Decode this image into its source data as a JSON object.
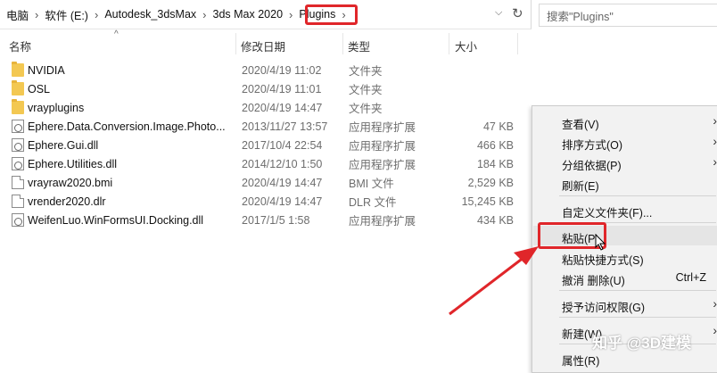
{
  "address": {
    "crumbs": [
      "电脑",
      "软件 (E:)",
      "Autodesk_3dsMax",
      "3ds Max 2020",
      "Plugins"
    ],
    "search_placeholder": "搜索\"Plugins\""
  },
  "columns": {
    "name": "名称",
    "date": "修改日期",
    "type": "类型",
    "size": "大小"
  },
  "files": [
    {
      "name": "NVIDIA",
      "date": "2020/4/19 11:02",
      "type": "文件夹",
      "size": "",
      "icon": "folder-icon"
    },
    {
      "name": "OSL",
      "date": "2020/4/19 11:01",
      "type": "文件夹",
      "size": "",
      "icon": "folder-icon"
    },
    {
      "name": "vrayplugins",
      "date": "2020/4/19 14:47",
      "type": "文件夹",
      "size": "",
      "icon": "folder-icon"
    },
    {
      "name": "Ephere.Data.Conversion.Image.Photo...",
      "date": "2013/11/27 13:57",
      "type": "应用程序扩展",
      "size": "47 KB",
      "icon": "dll-icon"
    },
    {
      "name": "Ephere.Gui.dll",
      "date": "2017/10/4 22:54",
      "type": "应用程序扩展",
      "size": "466 KB",
      "icon": "dll-icon"
    },
    {
      "name": "Ephere.Utilities.dll",
      "date": "2014/12/10 1:50",
      "type": "应用程序扩展",
      "size": "184 KB",
      "icon": "dll-icon"
    },
    {
      "name": "vrayraw2020.bmi",
      "date": "2020/4/19 14:47",
      "type": "BMI 文件",
      "size": "2,529 KB",
      "icon": "file-icon"
    },
    {
      "name": "vrender2020.dlr",
      "date": "2020/4/19 14:47",
      "type": "DLR 文件",
      "size": "15,245 KB",
      "icon": "file-icon"
    },
    {
      "name": "WeifenLuo.WinFormsUI.Docking.dll",
      "date": "2017/1/5 1:58",
      "type": "应用程序扩展",
      "size": "434 KB",
      "icon": "dll-icon"
    }
  ],
  "context_menu": {
    "view": "查看(V)",
    "sort": "排序方式(O)",
    "group": "分组依据(P)",
    "refresh": "刷新(E)",
    "customize": "自定义文件夹(F)...",
    "paste": "粘贴(P)",
    "paste_shortcut": "粘贴快捷方式(S)",
    "undo_delete": "撤消 删除(U)",
    "undo_shortcut": "Ctrl+Z",
    "grant_access": "授予访问权限(G)",
    "new": "新建(W)",
    "properties": "属性(R)"
  },
  "watermark": "知乎 @3D建模",
  "colors": {
    "highlight_red": "#e0262a",
    "folder_yellow": "#f3c852"
  }
}
